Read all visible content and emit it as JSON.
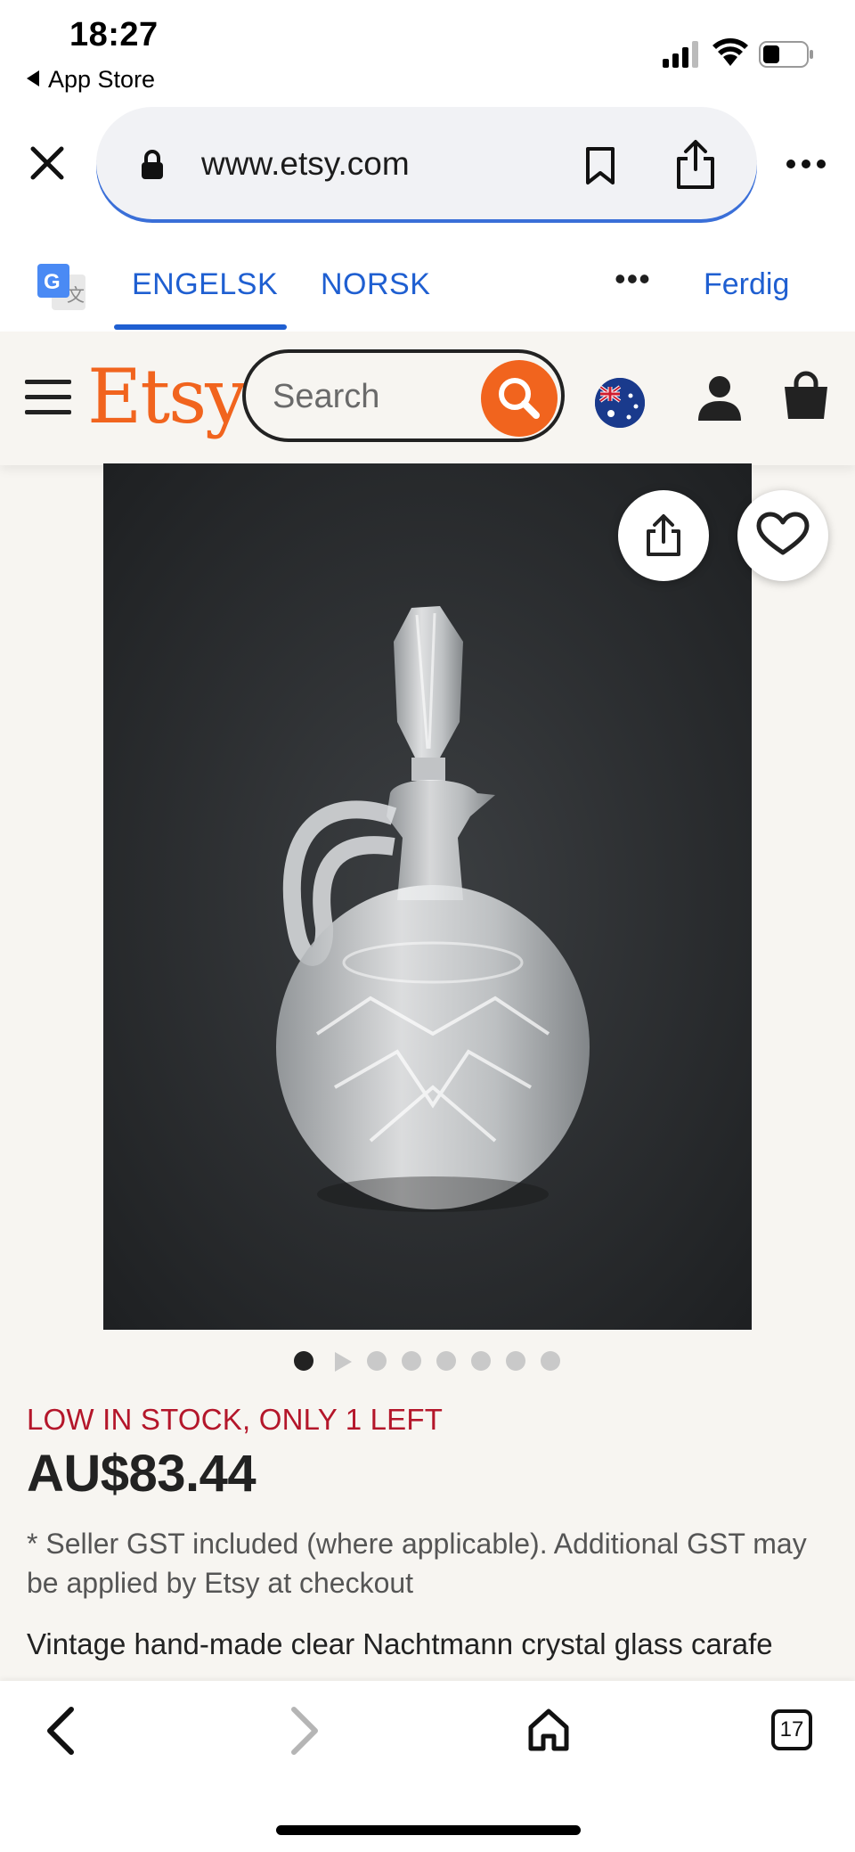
{
  "status_bar": {
    "time": "18:27",
    "back_app": "App Store"
  },
  "browser": {
    "url": "www.etsy.com",
    "tab_count": "17"
  },
  "translate_bar": {
    "lang_from": "ENGELSK",
    "lang_to": "NORSK",
    "more": "•••",
    "done": "Ferdig"
  },
  "etsy": {
    "logo": "Etsy",
    "search_placeholder": "Search"
  },
  "gallery": {
    "image_count": 8,
    "active_index": 0
  },
  "product": {
    "stock_notice": "LOW IN STOCK, ONLY 1 LEFT",
    "price": "AU$83.44",
    "gst_note": "* Seller GST included (where applicable). Additional GST may be applied by Etsy at checkout",
    "title": "Vintage hand-made clear Nachtmann crystal glass carafe"
  },
  "colors": {
    "etsy_orange": "#f1641e",
    "link_blue": "#1f5fd1",
    "stock_red": "#b4162a"
  }
}
